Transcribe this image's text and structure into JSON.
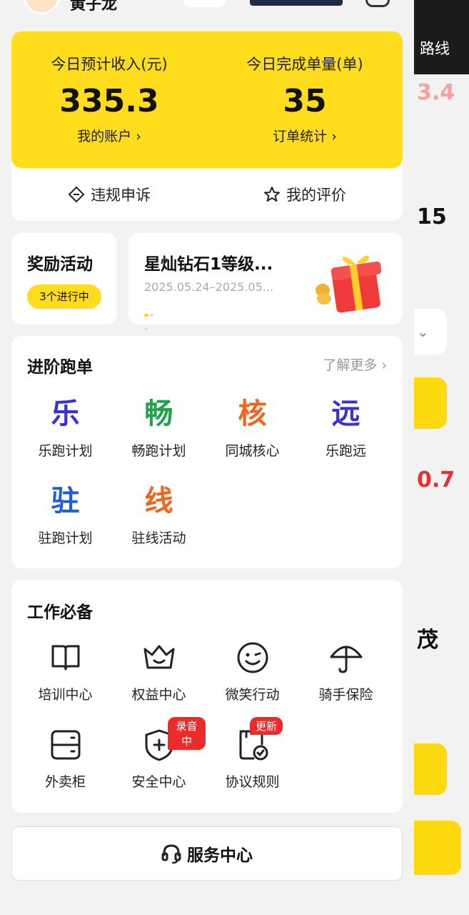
{
  "background": {
    "route_label": "路线",
    "num1": "3.4",
    "num2": "15",
    "num3": "0.7",
    "num4": "茂"
  },
  "header": {
    "user_name": "黄子龙"
  },
  "income": {
    "today_income_label": "今日预计收入(元)",
    "today_income_value": "335.3",
    "account_link": "我的账户 ›",
    "today_orders_label": "今日完成单量(单)",
    "today_orders_value": "35",
    "orders_link": "订单统计 ›",
    "appeal_label": "违规申诉",
    "rating_label": "我的评价"
  },
  "reward": {
    "title": "奖励活动",
    "pill": "3个进行中"
  },
  "promo": {
    "title": "星灿钻石1等级...",
    "date": "2025.05.24–2025.05..."
  },
  "advanced": {
    "title": "进阶跑单",
    "more": "了解更多 ›",
    "items": [
      {
        "glyph": "乐",
        "label": "乐跑计划",
        "color": "#3b2fd6"
      },
      {
        "glyph": "畅",
        "label": "畅跑计划",
        "color": "#1ea34a"
      },
      {
        "glyph": "核",
        "label": "同城核心",
        "color": "#f0641e"
      },
      {
        "glyph": "远",
        "label": "乐跑远",
        "color": "#3b2fd6"
      },
      {
        "glyph": "驻",
        "label": "驻跑计划",
        "color": "#1e5fd6"
      },
      {
        "glyph": "线",
        "label": "驻线活动",
        "color": "#f0641e"
      }
    ]
  },
  "work": {
    "title": "工作必备",
    "items": [
      {
        "icon": "book-icon",
        "label": "培训中心"
      },
      {
        "icon": "crown-icon",
        "label": "权益中心"
      },
      {
        "icon": "smile-icon",
        "label": "微笑行动"
      },
      {
        "icon": "umbrella-icon",
        "label": "骑手保险"
      },
      {
        "icon": "locker-icon",
        "label": "外卖柜"
      },
      {
        "icon": "shield-plus-icon",
        "label": "安全中心",
        "tag": "录音中"
      },
      {
        "icon": "document-check-icon",
        "label": "协议规则",
        "tag": "更新"
      }
    ]
  },
  "service": {
    "label": "服务中心"
  }
}
